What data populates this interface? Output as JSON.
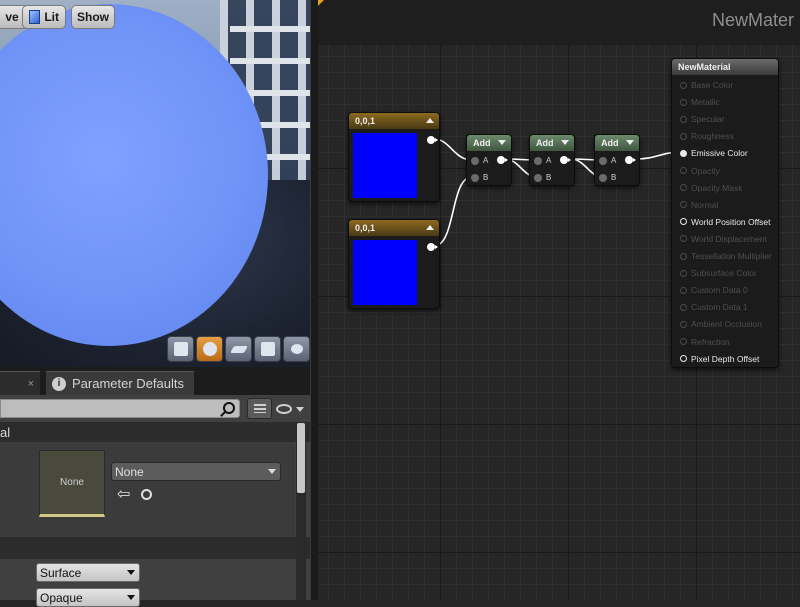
{
  "viewport": {
    "buttons": [
      {
        "id": "save",
        "label": "ve"
      },
      {
        "id": "lit",
        "label": "Lit",
        "icon": "cube-icon"
      },
      {
        "id": "show",
        "label": "Show"
      }
    ],
    "tools": [
      "cylinder-icon",
      "sphere-icon",
      "plane-icon",
      "cube-icon",
      "teapot-icon"
    ]
  },
  "details": {
    "tabs": [
      {
        "label": "",
        "close": "×"
      },
      {
        "label": "Parameter Defaults",
        "close": "",
        "icon": "info-icon"
      }
    ],
    "search_placeholder": "",
    "category_label": "al",
    "texture_thumb_label": "None",
    "texture_combo_value": "None",
    "domain_value": "Surface",
    "blend_value": "Opaque"
  },
  "graph": {
    "title": "NewMater",
    "constant_nodes": [
      {
        "label": "0,0,1",
        "color": "#0000ff"
      },
      {
        "label": "0,0,1",
        "color": "#0000ff"
      }
    ],
    "add_nodes": [
      {
        "label": "Add",
        "in_a": "A",
        "in_b": "B"
      },
      {
        "label": "Add",
        "in_a": "A",
        "in_b": "B"
      },
      {
        "label": "Add",
        "in_a": "A",
        "in_b": "B"
      }
    ],
    "material_node": {
      "title": "NewMaterial",
      "inputs": [
        {
          "label": "Base Color",
          "state": "off"
        },
        {
          "label": "Metallic",
          "state": "off"
        },
        {
          "label": "Specular",
          "state": "off"
        },
        {
          "label": "Roughness",
          "state": "off"
        },
        {
          "label": "Emissive Color",
          "state": "on"
        },
        {
          "label": "Opacity",
          "state": "off"
        },
        {
          "label": "Opacity Mask",
          "state": "off"
        },
        {
          "label": "Normal",
          "state": "off"
        },
        {
          "label": "World Position Offset",
          "state": "semi"
        },
        {
          "label": "World Displacement",
          "state": "off"
        },
        {
          "label": "Tessellation Multiplier",
          "state": "off"
        },
        {
          "label": "Subsurface Color",
          "state": "off"
        },
        {
          "label": "Custom Data 0",
          "state": "off"
        },
        {
          "label": "Custom Data 1",
          "state": "off"
        },
        {
          "label": "Ambient Occlusion",
          "state": "off"
        },
        {
          "label": "Refraction",
          "state": "off"
        },
        {
          "label": "Pixel Depth Offset",
          "state": "semi"
        }
      ]
    }
  },
  "colors": {
    "accent": "#e2a21f",
    "swatch": "#0000ff",
    "sphere": "#6f93f7"
  }
}
